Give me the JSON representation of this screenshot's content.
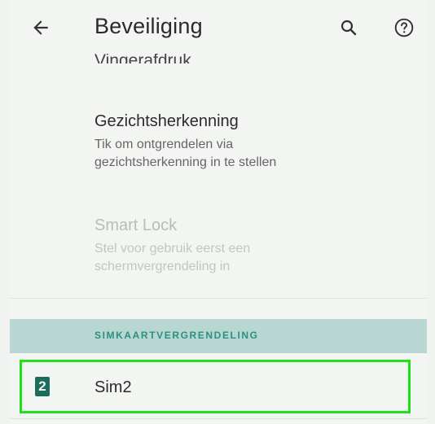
{
  "appbar": {
    "title": "Beveiliging",
    "back_icon": "arrow-left-icon",
    "search_icon": "search-icon",
    "help_icon": "help-circle-icon"
  },
  "list": {
    "partial_item_title": "Vingerafdruk",
    "items": [
      {
        "title": "Gezichtsherkenning",
        "summary_line1": "Tik om ontgrendelen via",
        "summary_line2": "gezichtsherkenning in te stellen",
        "enabled": true
      },
      {
        "title": "Smart Lock",
        "summary_line1": "Stel voor gebruik eerst een",
        "summary_line2": "schermvergrendeling in",
        "enabled": false
      }
    ]
  },
  "section": {
    "header": "SIMKAARTVERGRENDELING"
  },
  "sim": {
    "slot_number": "2",
    "label": "Sim2"
  },
  "colors": {
    "section_header_bg": "#b9d7d2",
    "section_header_text": "#2c8f80",
    "highlight_border": "#1fe01f",
    "sim_icon": "#1d6b5c"
  }
}
